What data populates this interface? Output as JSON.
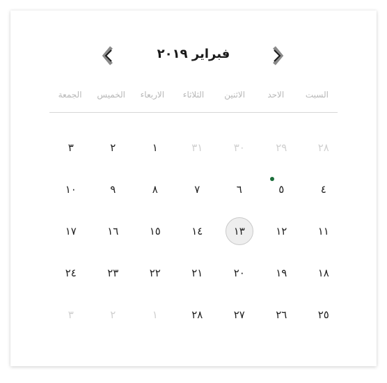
{
  "calendar": {
    "title": "فبراير ٢٠١٩",
    "weekdays": [
      "السبت",
      "الاحد",
      "الاثنين",
      "الثلاثاء",
      "الاربعاء",
      "الخميس",
      "الجمعة"
    ],
    "weeks": [
      [
        "٢٨",
        "٢٩",
        "٣٠",
        "٣١",
        "١",
        "٢",
        "٣"
      ],
      [
        "٤",
        "٥",
        "٦",
        "٧",
        "٨",
        "٩",
        "١٠"
      ],
      [
        "١١",
        "١٢",
        "١٣",
        "١٤",
        "١٥",
        "١٦",
        "١٧"
      ],
      [
        "١٨",
        "١٩",
        "٢٠",
        "٢١",
        "٢٢",
        "٢٣",
        "٢٤"
      ],
      [
        "٢٥",
        "٢٦",
        "٢٧",
        "٢٨",
        "١",
        "٢",
        "٣"
      ]
    ],
    "muted_cells": [
      [
        0,
        0
      ],
      [
        0,
        1
      ],
      [
        0,
        2
      ],
      [
        0,
        3
      ],
      [
        4,
        4
      ],
      [
        4,
        5
      ],
      [
        4,
        6
      ]
    ],
    "selected_cell": [
      2,
      2
    ],
    "event_dot_cells": [
      [
        1,
        1
      ]
    ],
    "prev_icon": "chevron-left-icon",
    "next_icon": "chevron-right-icon",
    "colors": {
      "event_dot": "#1b6e3a",
      "selected_bg": "#eeeeee",
      "muted_text": "#d0d0d0",
      "weekday_text": "#b8b8b8"
    }
  }
}
